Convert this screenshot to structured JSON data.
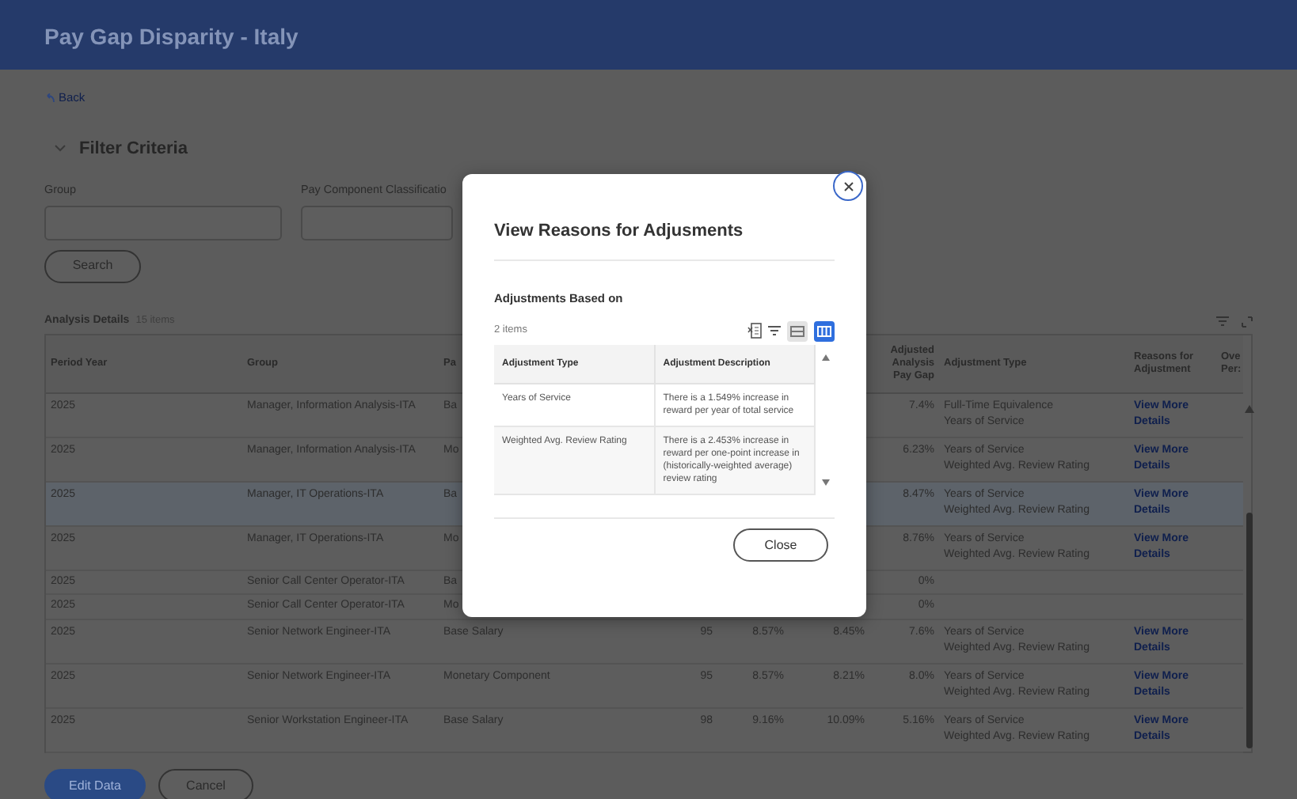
{
  "header": {
    "title": "Pay Gap Disparity - Italy"
  },
  "back_link": "Back",
  "filter": {
    "title": "Filter Criteria",
    "expanded": true,
    "fields": [
      {
        "label": "Group"
      },
      {
        "label": "Pay Component Classificatio"
      }
    ],
    "search_button": "Search"
  },
  "analysis": {
    "title": "Analysis Details",
    "count": "15 items",
    "columns": [
      "Period Year",
      "Group",
      "Pa",
      null,
      null,
      null,
      "Adjusted Analysis Pay Gap",
      "Adjustment Type",
      "Reasons for Adjustment",
      "Ove Per:"
    ],
    "rows": [
      {
        "selected": false,
        "cells": [
          "2025",
          "Manager, Information Analysis-ITA",
          "Ba",
          null,
          null,
          null,
          "7.4%"
        ],
        "adjustment_type": [
          "Full-Time Equivalence",
          "Years of Service"
        ],
        "reasons_link": "View More Details"
      },
      {
        "selected": false,
        "cells": [
          "2025",
          "Manager, Information Analysis-ITA",
          "Mo",
          null,
          null,
          null,
          "6.23%"
        ],
        "adjustment_type": [
          "Years of Service",
          "Weighted Avg. Review Rating"
        ],
        "reasons_link": "View More Details"
      },
      {
        "selected": true,
        "cells": [
          "2025",
          "Manager, IT Operations-ITA",
          "Ba",
          null,
          null,
          null,
          "8.47%"
        ],
        "adjustment_type": [
          "Years of Service",
          "Weighted Avg. Review Rating"
        ],
        "reasons_link": "View More Details"
      },
      {
        "selected": false,
        "cells": [
          "2025",
          "Manager, IT Operations-ITA",
          "Mo",
          null,
          null,
          null,
          "8.76%"
        ],
        "adjustment_type": [
          "Years of Service",
          "Weighted Avg. Review Rating"
        ],
        "reasons_link": "View More Details"
      },
      {
        "selected": false,
        "cells": [
          "2025",
          "Senior Call Center Operator-ITA",
          "Ba",
          null,
          null,
          null,
          "0%"
        ],
        "adjustment_type": []
      },
      {
        "selected": false,
        "cells": [
          "2025",
          "Senior Call Center Operator-ITA",
          "Mo",
          null,
          null,
          null,
          "0%"
        ],
        "adjustment_type": []
      },
      {
        "selected": false,
        "cells": [
          "2025",
          "Senior Network Engineer-ITA",
          "Base Salary",
          "95",
          "8.57%",
          "8.45%",
          "7.6%"
        ],
        "adjustment_type": [
          "Years of Service",
          "Weighted Avg. Review Rating"
        ],
        "reasons_link": "View More Details"
      },
      {
        "selected": false,
        "cells": [
          "2025",
          "Senior Network Engineer-ITA",
          "Monetary Component",
          "95",
          "8.57%",
          "8.21%",
          "8.0%"
        ],
        "adjustment_type": [
          "Years of Service",
          "Weighted Avg. Review Rating"
        ],
        "reasons_link": "View More Details"
      },
      {
        "selected": false,
        "cells": [
          "2025",
          "Senior Workstation Engineer-ITA",
          "Base Salary",
          "98",
          "9.16%",
          "10.09%",
          "5.16%"
        ],
        "adjustment_type": [
          "Years of Service",
          "Weighted Avg. Review Rating"
        ],
        "reasons_link": "View More Details"
      }
    ]
  },
  "footer_buttons": [
    {
      "label": "Edit Data",
      "kind": "primary"
    },
    {
      "label": "Cancel",
      "kind": "secondary"
    }
  ],
  "modal": {
    "title": "View Reasons for Adjusments",
    "section_title": "Adjustments Based on",
    "count": "2 items",
    "view_toggles": [
      {
        "selected": false
      },
      {
        "selected": true
      }
    ],
    "columns": [
      "Adjustment Type",
      "Adjustment Description"
    ],
    "rows": [
      {
        "type": "Years of Service",
        "description": "There is a 1.549% increase in reward per year of total service"
      },
      {
        "type": "Weighted Avg. Review Rating",
        "description": "There is a 2.453% increase in reward per one-point increase in (historically-weighted average) review rating"
      }
    ],
    "close_button": "Close"
  }
}
